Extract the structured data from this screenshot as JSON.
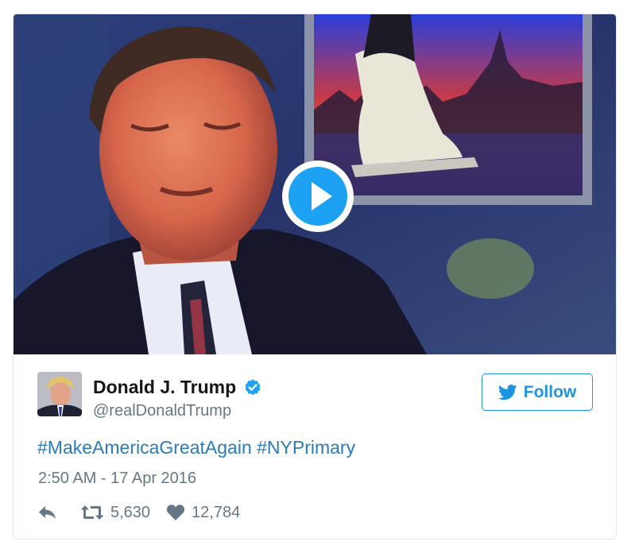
{
  "media": {
    "play_icon": "play-icon"
  },
  "author": {
    "display_name": "Donald J. Trump",
    "handle": "@realDonaldTrump",
    "verified_icon": "verified-badge-icon",
    "avatar_icon": "avatar-photo"
  },
  "follow": {
    "label": "Follow",
    "icon": "twitter-bird-icon"
  },
  "tweet": {
    "hashtags": [
      "#MakeAmericaGreatAgain",
      "#NYPrimary"
    ],
    "timestamp": "2:50 AM - 17 Apr 2016"
  },
  "actions": {
    "reply_icon": "reply-icon",
    "retweet_icon": "retweet-icon",
    "retweet_count": "5,630",
    "like_icon": "heart-icon",
    "like_count": "12,784"
  },
  "colors": {
    "link": "#2b7bb9",
    "follow_blue": "#1b95e0",
    "muted_text": "#657786",
    "play_blue": "#1da1f2"
  }
}
